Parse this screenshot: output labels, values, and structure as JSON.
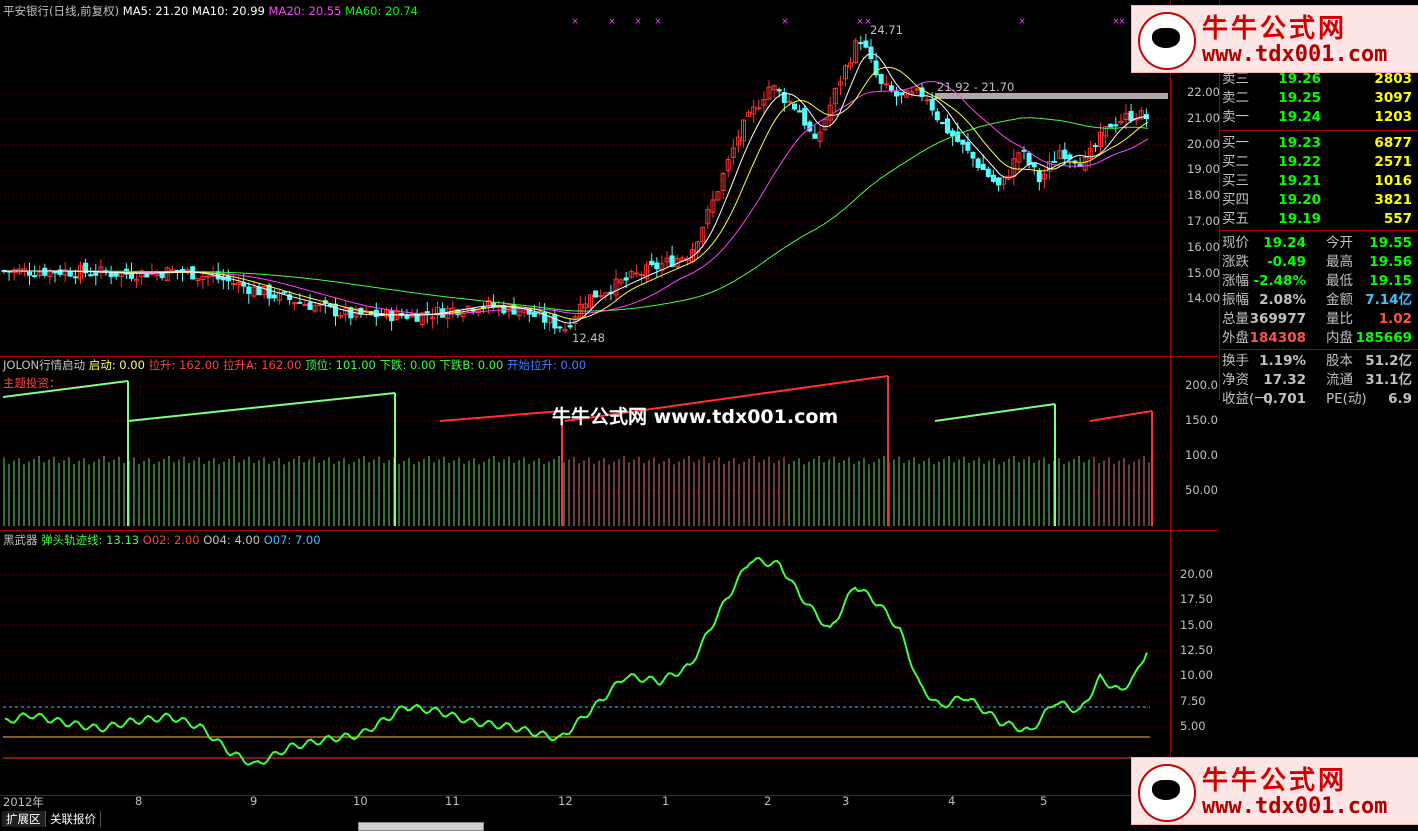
{
  "top_indicator": {
    "title": "平安银行(日线,前复权)",
    "ma5": "MA5: 21.20",
    "ma10": "MA10: 20.99",
    "ma20": "MA20: 20.55",
    "ma60": "MA60: 20.74",
    "colors": {
      "ma5": "#ffffff",
      "ma10": "#ffff00",
      "ma20": "#ff00ff",
      "ma60": "#00ff00"
    }
  },
  "price_chart": {
    "y_ticks": [
      "22.00",
      "21.00",
      "20.00",
      "19.00",
      "18.00",
      "17.00",
      "16.00",
      "15.00",
      "14.00"
    ],
    "high_label": "24.71",
    "low_label": "12.48",
    "range_label": "21.92 - 21.70"
  },
  "mid_indicator": {
    "title": "JOLON行情启动",
    "p1": "启动: 0.00",
    "p2": "拉升: 162.00",
    "p3": "拉升A: 162.00",
    "p4": "顶位: 101.00",
    "p5": "下跌: 0.00",
    "p6": "下跌B: 0.00",
    "p7": "开始拉升: 0.00",
    "sub_label": "主题投资：",
    "y_ticks": [
      "200.0",
      "150.0",
      "100.0",
      "50.00"
    ]
  },
  "bottom_indicator": {
    "title": "黑武器",
    "p1": "弹头轨迹线: 13.13",
    "p2": "O02: 2.00",
    "p3": "O04: 4.00",
    "p4": "O07: 7.00",
    "y_ticks": [
      "20.00",
      "17.50",
      "15.00",
      "12.50",
      "10.00",
      "7.50",
      "5.00"
    ]
  },
  "months": [
    "2012年",
    "8",
    "9",
    "10",
    "11",
    "12",
    "1",
    "2",
    "3",
    "4",
    "5"
  ],
  "bottom_tabs": [
    "扩展区",
    "关联报价"
  ],
  "watermark": "牛牛公式网 www.tdx001.com",
  "logo": {
    "cn": "牛牛公式网",
    "url": "www.tdx001.com"
  },
  "quote": {
    "sell": [
      {
        "label": "卖三",
        "price": "19.26",
        "vol": "2803"
      },
      {
        "label": "卖二",
        "price": "19.25",
        "vol": "3097"
      },
      {
        "label": "卖一",
        "price": "19.24",
        "vol": "1203"
      }
    ],
    "buy": [
      {
        "label": "买一",
        "price": "19.23",
        "vol": "6877"
      },
      {
        "label": "买二",
        "price": "19.22",
        "vol": "2571"
      },
      {
        "label": "买三",
        "price": "19.21",
        "vol": "1016"
      },
      {
        "label": "买四",
        "price": "19.20",
        "vol": "3821"
      },
      {
        "label": "买五",
        "price": "19.19",
        "vol": "557"
      }
    ],
    "stats": [
      {
        "l1": "现价",
        "v1": "19.24",
        "c1": "#00ff00",
        "l2": "今开",
        "v2": "19.55",
        "c2": "#00ff00"
      },
      {
        "l1": "涨跌",
        "v1": "-0.49",
        "c1": "#00ff00",
        "l2": "最高",
        "v2": "19.56",
        "c2": "#00ff00"
      },
      {
        "l1": "涨幅",
        "v1": "-2.48%",
        "c1": "#00ff00",
        "l2": "最低",
        "v2": "19.15",
        "c2": "#00ff00"
      },
      {
        "l1": "振幅",
        "v1": "2.08%",
        "c1": "#c0c0c0",
        "l2": "金额",
        "v2": "7.14亿",
        "c2": "#40c0ff"
      },
      {
        "l1": "总量",
        "v1": "369977",
        "c1": "#c0c0c0",
        "l2": "量比",
        "v2": "1.02",
        "c2": "#ff5050"
      },
      {
        "l1": "外盘",
        "v1": "184308",
        "c1": "#ff5050",
        "l2": "内盘",
        "v2": "185669",
        "c2": "#00ff00"
      },
      {
        "l1": "换手",
        "v1": "1.19%",
        "c1": "#c0c0c0",
        "l2": "股本",
        "v2": "51.2亿",
        "c2": "#c0c0c0"
      },
      {
        "l1": "净资",
        "v1": "17.32",
        "c1": "#c0c0c0",
        "l2": "流通",
        "v2": "31.1亿",
        "c2": "#c0c0c0"
      },
      {
        "l1": "收益(一)",
        "v1": "0.701",
        "c1": "#c0c0c0",
        "l2": "PE(动)",
        "v2": "6.9",
        "c2": "#c0c0c0"
      }
    ]
  }
}
